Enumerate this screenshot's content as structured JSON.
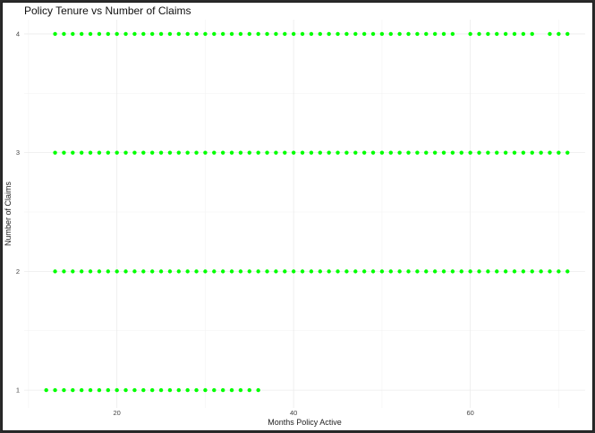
{
  "chart_data": {
    "type": "scatter",
    "title": "Policy Tenure vs Number of Claims",
    "xlabel": "Months Policy Active",
    "ylabel": "Number of Claims",
    "xlim": [
      9.5,
      73
    ],
    "ylim": [
      0.85,
      4.12
    ],
    "xticks": [
      20,
      40,
      60
    ],
    "yticks": [
      1,
      2,
      3,
      4
    ],
    "grid": true,
    "point_color": "#00ff00",
    "groups": [
      {
        "y": 1,
        "x_ranges": [
          [
            12,
            36
          ]
        ]
      },
      {
        "y": 2,
        "x_ranges": [
          [
            13,
            71
          ]
        ]
      },
      {
        "y": 3,
        "x_ranges": [
          [
            13,
            71
          ]
        ]
      },
      {
        "y": 4,
        "x_ranges": [
          [
            13,
            58
          ],
          [
            60,
            67
          ],
          [
            69,
            71
          ]
        ]
      }
    ]
  }
}
